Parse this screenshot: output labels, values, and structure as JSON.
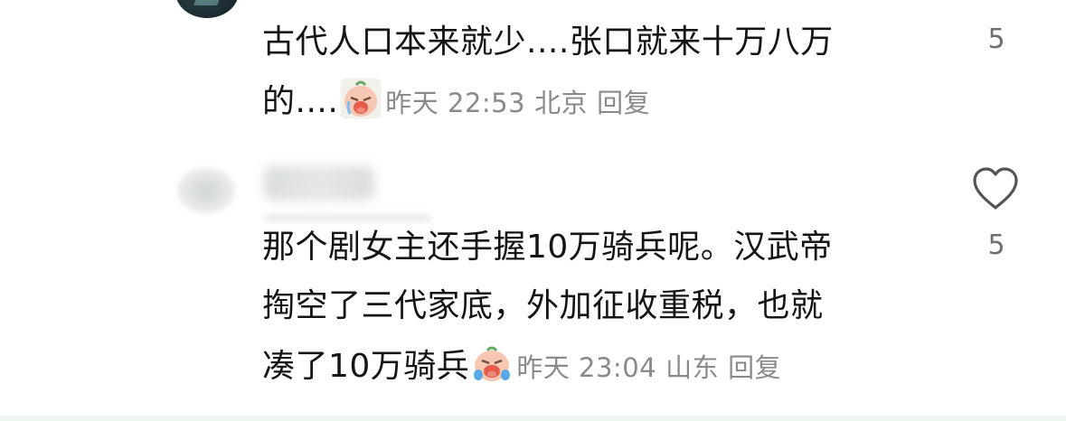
{
  "comments": [
    {
      "text_lines": [
        "古代人口本来就少....张口就来十万八万",
        "的...."
      ],
      "time": "昨天 22:53",
      "location": "北京",
      "reply_label": "回复",
      "likes": "5",
      "emoji_icon": "crying-face-emoji-icon",
      "avatar_icon": "user-avatar"
    },
    {
      "text_lines": [
        "那个剧女主还手握10万骑兵呢。汉武帝",
        "掏空了三代家底，外加征收重税，也就",
        "凑了10万骑兵"
      ],
      "time": "昨天 23:04",
      "location": "山东",
      "reply_label": "回复",
      "likes": "5",
      "emoji_icon": "crying-face-emoji-icon",
      "avatar_icon": "blurred-user-avatar",
      "like_icon": "heart-icon"
    }
  ],
  "colors": {
    "text": "#151515",
    "meta": "#8a8a8a",
    "likes": "#6f6f6f",
    "emoji_face": "#f6c8b4",
    "emoji_mouth": "#e65a4a"
  }
}
